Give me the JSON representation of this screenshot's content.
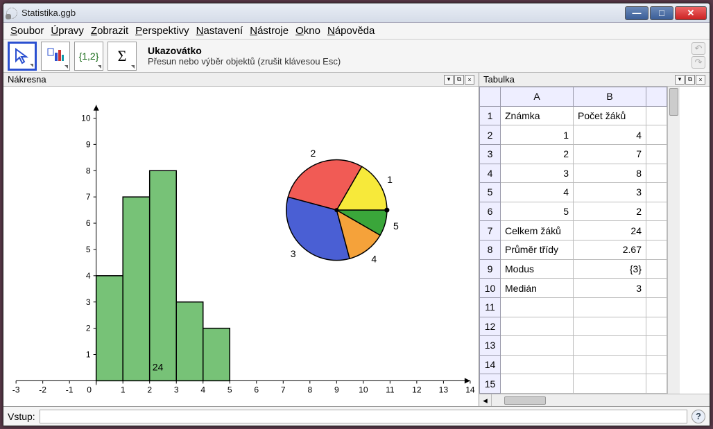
{
  "window": {
    "title": "Statistika.ggb"
  },
  "menu": {
    "items": [
      "Soubor",
      "Úpravy",
      "Zobrazit",
      "Perspektivy",
      "Nastavení",
      "Nástroje",
      "Okno",
      "Nápověda"
    ]
  },
  "toolbar": {
    "tool_title": "Ukazovátko",
    "tool_desc": "Přesun nebo výběr objektů (zrušit klávesou Esc)"
  },
  "panels": {
    "graphics_title": "Nákresna",
    "spreadsheet_title": "Tabulka"
  },
  "spreadsheet": {
    "columns": [
      "A",
      "B"
    ],
    "rows": [
      {
        "n": "1",
        "a": "Známka",
        "b": "Počet žáků",
        "a_align": "left",
        "b_align": "left"
      },
      {
        "n": "2",
        "a": "1",
        "b": "4",
        "a_align": "right",
        "b_align": "right"
      },
      {
        "n": "3",
        "a": "2",
        "b": "7",
        "a_align": "right",
        "b_align": "right"
      },
      {
        "n": "4",
        "a": "3",
        "b": "8",
        "a_align": "right",
        "b_align": "right"
      },
      {
        "n": "5",
        "a": "4",
        "b": "3",
        "a_align": "right",
        "b_align": "right"
      },
      {
        "n": "6",
        "a": "5",
        "b": "2",
        "a_align": "right",
        "b_align": "right"
      },
      {
        "n": "7",
        "a": "Celkem žáků",
        "b": "24",
        "a_align": "left",
        "b_align": "right"
      },
      {
        "n": "8",
        "a": "Průměr třídy",
        "b": "2.67",
        "a_align": "left",
        "b_align": "right"
      },
      {
        "n": "9",
        "a": "Modus",
        "b": "{3}",
        "a_align": "left",
        "b_align": "right"
      },
      {
        "n": "10",
        "a": "Medián",
        "b": "3",
        "a_align": "left",
        "b_align": "right"
      },
      {
        "n": "11",
        "a": "",
        "b": ""
      },
      {
        "n": "12",
        "a": "",
        "b": ""
      },
      {
        "n": "13",
        "a": "",
        "b": ""
      },
      {
        "n": "14",
        "a": "",
        "b": ""
      },
      {
        "n": "15",
        "a": "",
        "b": ""
      }
    ]
  },
  "inputbar": {
    "label": "Vstup:"
  },
  "chart_data": [
    {
      "type": "bar",
      "title": "",
      "xlabel": "",
      "ylabel": "",
      "categories": [
        0,
        1,
        2,
        3,
        4
      ],
      "values": [
        4,
        7,
        8,
        3,
        2
      ],
      "annotation": "24",
      "xlim": [
        -3,
        14
      ],
      "ylim": [
        0,
        10.5
      ],
      "color": "#77c277"
    },
    {
      "type": "pie",
      "title": "",
      "series": [
        {
          "name": "1",
          "value": 4,
          "color": "#f7e93a"
        },
        {
          "name": "2",
          "value": 7,
          "color": "#f15b55"
        },
        {
          "name": "3",
          "value": 8,
          "color": "#4a5fd4"
        },
        {
          "name": "4",
          "value": 3,
          "color": "#f5a23a"
        },
        {
          "name": "5",
          "value": 2,
          "color": "#3aa63a"
        }
      ],
      "total": 24
    }
  ]
}
